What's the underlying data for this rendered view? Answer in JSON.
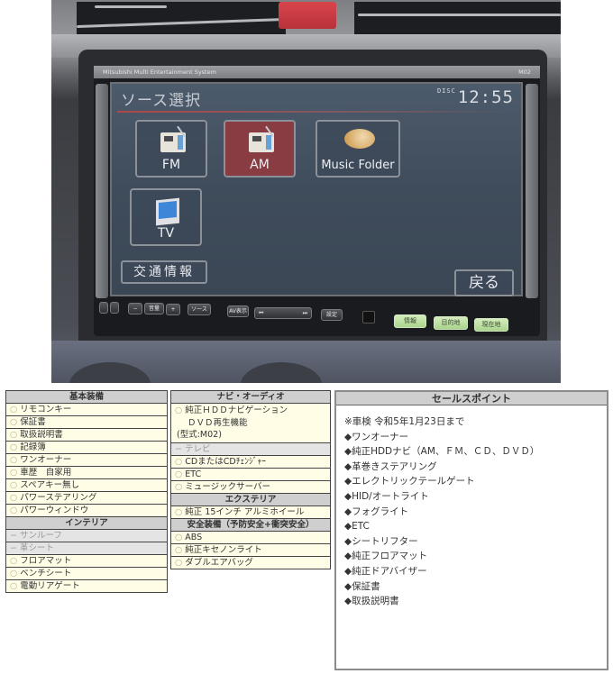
{
  "photo": {
    "unit_brand": "Mitsubishi Multi Entertainment System",
    "unit_model": "M02",
    "screen": {
      "title": "ソース選択",
      "clock_prefix": "DISC",
      "clock": "12:55",
      "sources": [
        {
          "label": "FM",
          "icon": "radio-icon",
          "active": false
        },
        {
          "label": "AM",
          "icon": "radio-icon",
          "active": true
        },
        {
          "label": "Music Folder",
          "icon": "music-folder-icon",
          "active": false
        },
        {
          "label": "TV",
          "icon": "tv-icon",
          "active": false
        }
      ],
      "traffic_button": "交通情報",
      "back_button": "戻る"
    },
    "hardware_buttons": {
      "volume_minus": "−",
      "volume_label": "音量",
      "volume_plus": "+",
      "source": "ソース",
      "display": "AV表示",
      "prev": "⏮",
      "next": "⏭",
      "settings": "設定",
      "info": "情報",
      "destination": "目的地",
      "current_location": "現在地"
    }
  },
  "basic_equipment": {
    "header": "基本装備",
    "items": [
      {
        "mark": "○",
        "label": "リモコンキー",
        "enabled": true
      },
      {
        "mark": "○",
        "label": "保証書",
        "enabled": true
      },
      {
        "mark": "○",
        "label": "取扱説明書",
        "enabled": true
      },
      {
        "mark": "○",
        "label": "記録簿",
        "enabled": true
      },
      {
        "mark": "○",
        "label": "ワンオーナー",
        "enabled": true
      },
      {
        "mark": "○",
        "label": "車歴　自家用",
        "enabled": true
      },
      {
        "mark": "○",
        "label": "スペアキー無し",
        "enabled": true
      },
      {
        "mark": "○",
        "label": "パワーステアリング",
        "enabled": true
      },
      {
        "mark": "○",
        "label": "パワーウィンドウ",
        "enabled": true
      }
    ]
  },
  "interior": {
    "header": "インテリア",
    "items": [
      {
        "mark": "−",
        "label": "サンルーフ",
        "enabled": false
      },
      {
        "mark": "−",
        "label": "革シート",
        "enabled": false
      },
      {
        "mark": "○",
        "label": "フロアマット",
        "enabled": true
      },
      {
        "mark": "○",
        "label": "ベンチシート",
        "enabled": true
      },
      {
        "mark": "○",
        "label": "電動リアゲート",
        "enabled": true
      }
    ]
  },
  "navi_audio": {
    "header": "ナビ・オーディオ",
    "nav_item": {
      "mark": "○",
      "line1": "純正ＨＤＤナビゲーション",
      "line2": "ＤＶＤ再生機能",
      "line3": "(型式:M02)"
    },
    "items": [
      {
        "mark": "−",
        "label": "テレビ",
        "enabled": false
      },
      {
        "mark": "○",
        "label": "CDまたはCDﾁｪﾝｼﾞｬｰ",
        "enabled": true
      },
      {
        "mark": "○",
        "label": "ETC",
        "enabled": true
      },
      {
        "mark": "○",
        "label": "ミュージックサーバー",
        "enabled": true
      }
    ]
  },
  "exterior": {
    "header": "エクステリア",
    "items": [
      {
        "mark": "○",
        "label": "純正 15インチ アルミホイール",
        "enabled": true
      }
    ]
  },
  "safety": {
    "header": "安全装備（予防安全+衝突安全）",
    "items": [
      {
        "mark": "○",
        "label": "ABS",
        "enabled": true
      },
      {
        "mark": "○",
        "label": "純正キセノンライト",
        "enabled": true
      },
      {
        "mark": "○",
        "label": "ダブルエアバッグ",
        "enabled": true
      }
    ]
  },
  "sales_points": {
    "header": "セールスポイント",
    "items": [
      "※車検 令和5年1月23日まで",
      "◆ワンオーナー",
      "◆純正HDDナビ（AM、ＦＭ、ＣＤ、ＤＶＤ）",
      "◆革巻きステアリング",
      "◆エレクトリックテールゲート",
      "◆HID/オートライト",
      "◆フォグライト",
      "◆ETC",
      "◆シートリフター",
      "◆純正フロアマット",
      "◆純正ドアバイザー",
      "◆保証書",
      "◆取扱説明書"
    ]
  }
}
